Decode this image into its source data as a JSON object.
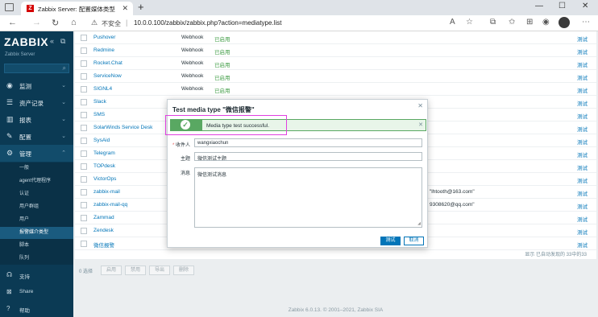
{
  "browser": {
    "tab_title": "Zabbix Server: 配置媒体类型",
    "tab_favicon": "Z",
    "url_insecure": "不安全",
    "url": "10.0.0.100/zabbix/zabbix.php?action=mediatype.list"
  },
  "sidebar": {
    "logo": "ZABBIX",
    "server_name": "Zabbix Server",
    "menu": [
      {
        "icon": "eye-icon",
        "label": "监测"
      },
      {
        "icon": "list-icon",
        "label": "资产记录"
      },
      {
        "icon": "chart-icon",
        "label": "报表"
      },
      {
        "icon": "wrench-icon",
        "label": "配置"
      },
      {
        "icon": "gear-icon",
        "label": "管理"
      }
    ],
    "submenu": [
      "一般",
      "agent代理程序",
      "认证",
      "用户群组",
      "用户",
      "报警媒介类型",
      "脚本",
      "队列"
    ],
    "bottom": [
      {
        "icon": "headset-icon",
        "label": "支持"
      },
      {
        "icon": "share-icon",
        "label": "Share"
      },
      {
        "icon": "help-icon",
        "label": "帮助"
      }
    ]
  },
  "table": {
    "rows": [
      {
        "name": "Pushover",
        "type": "Webhook",
        "status": "已启用",
        "detail": "",
        "test": "测试"
      },
      {
        "name": "Redmine",
        "type": "Webhook",
        "status": "已启用",
        "detail": "",
        "test": "测试"
      },
      {
        "name": "Rocket.Chat",
        "type": "Webhook",
        "status": "已启用",
        "detail": "",
        "test": "测试"
      },
      {
        "name": "ServiceNow",
        "type": "Webhook",
        "status": "已启用",
        "detail": "",
        "test": "测试"
      },
      {
        "name": "SIGNL4",
        "type": "Webhook",
        "status": "已启用",
        "detail": "",
        "test": "测试"
      },
      {
        "name": "Slack",
        "type": "",
        "status": "",
        "detail": "",
        "test": "测试"
      },
      {
        "name": "SMS",
        "type": "",
        "status": "",
        "detail": "",
        "test": "测试"
      },
      {
        "name": "SolarWinds Service Desk",
        "type": "",
        "status": "",
        "detail": "",
        "test": "测试"
      },
      {
        "name": "SysAid",
        "type": "",
        "status": "",
        "detail": "",
        "test": "测试"
      },
      {
        "name": "Telegram",
        "type": "",
        "status": "",
        "detail": "",
        "test": "测试"
      },
      {
        "name": "TOPdesk",
        "type": "",
        "status": "",
        "detail": "",
        "test": "测试"
      },
      {
        "name": "VictorOps",
        "type": "",
        "status": "",
        "detail": "",
        "test": "测试"
      },
      {
        "name": "zabbix-mail",
        "type": "",
        "status": "",
        "detail": "\"lhtooth@163.com\"",
        "test": "测试"
      },
      {
        "name": "zabbix-mail-qq",
        "type": "",
        "status": "",
        "detail": "9308620@qq.com\"",
        "test": "测试"
      },
      {
        "name": "Zammad",
        "type": "",
        "status": "",
        "detail": "",
        "test": "测试"
      },
      {
        "name": "Zendesk",
        "type": "",
        "status": "",
        "detail": "",
        "test": "测试"
      },
      {
        "name": "微信报警",
        "type": "",
        "status": "",
        "detail": "",
        "test": "测试"
      }
    ],
    "pager": "显示 已自动发现的 33中的33"
  },
  "actions": {
    "selected": "0 选择",
    "buttons": [
      "启用",
      "禁用",
      "导出",
      "删除"
    ]
  },
  "footer": "Zabbix 6.0.13. © 2001–2021, Zabbix SIA",
  "modal": {
    "title": "Test media type \"微信报警\"",
    "message": "Media type test successful.",
    "fields": {
      "send_to_label": "收件人",
      "send_to_value": "wangxiaochun",
      "subject_label": "主题",
      "subject_value": "微信测试主题",
      "message_label": "消息",
      "message_value": "微信测试消息"
    },
    "test_button": "测试",
    "cancel_button": "取消"
  },
  "colors": {
    "sidebar_bg": "#0b3a54",
    "link": "#0275b8",
    "success": "#59a862",
    "highlight": "#e040e0"
  }
}
